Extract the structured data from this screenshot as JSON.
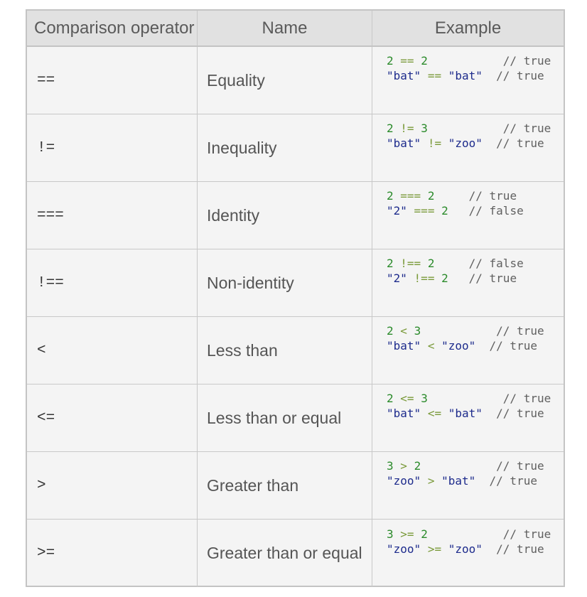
{
  "headers": {
    "operator": "Comparison operator",
    "name": "Name",
    "example": "Example"
  },
  "rows": [
    {
      "op": "==",
      "name": "Equality",
      "line1": "2 == 2           // true",
      "line2": "\"bat\" == \"bat\"  // true"
    },
    {
      "op": "!=",
      "name": "Inequality",
      "line1": "2 != 3           // true",
      "line2": "\"bat\" != \"zoo\"  // true"
    },
    {
      "op": "===",
      "name": "Identity",
      "line1": "2 === 2     // true",
      "line2": "\"2\" === 2   // false"
    },
    {
      "op": "!==",
      "name": "Non-identity",
      "line1": "2 !== 2     // false",
      "line2": "\"2\" !== 2   // true"
    },
    {
      "op": "<",
      "name": "Less than",
      "line1": "2 < 3           // true",
      "line2": "\"bat\" < \"zoo\"  // true"
    },
    {
      "op": "<=",
      "name": "Less than or equal",
      "line1": "2 <= 3           // true",
      "line2": "\"bat\" <= \"bat\"  // true"
    },
    {
      "op": ">",
      "name": "Greater than",
      "line1": "3 > 2           // true",
      "line2": "\"zoo\" > \"bat\"  // true"
    },
    {
      "op": ">=",
      "name": "Greater than or equal",
      "line1": "3 >= 2           // true",
      "line2": "\"zoo\" >= \"zoo\"  // true"
    }
  ],
  "colors": {
    "number": "#2a8a2a",
    "string": "#1d2b8c",
    "operator": "#7a9a3a",
    "comment": "#606060"
  }
}
